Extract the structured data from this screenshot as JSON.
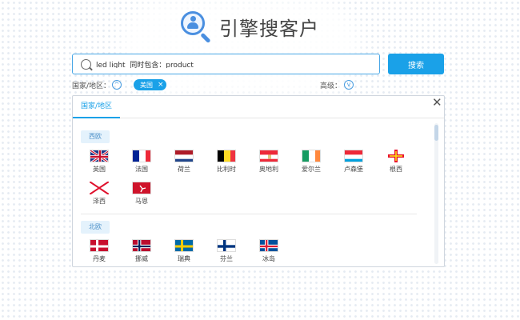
{
  "header": {
    "title": "引擎搜客户",
    "logo_icon": "search-person-icon"
  },
  "search": {
    "value": "led light  同时包含：product",
    "button_label": "搜索"
  },
  "filters": {
    "country_label": "国家/地区：",
    "selected_tag": "美国",
    "advanced_label": "高级："
  },
  "panel": {
    "tab_label": "国家/地区",
    "regions": [
      {
        "name": "西欧",
        "countries": [
          "英国",
          "法国",
          "荷兰",
          "比利时",
          "奥地利",
          "爱尔兰",
          "卢森堡",
          "根西",
          "泽西",
          "马恩"
        ]
      },
      {
        "name": "北欧",
        "countries": [
          "丹麦",
          "挪威",
          "瑞典",
          "芬兰",
          "冰岛"
        ]
      }
    ]
  },
  "colors": {
    "accent": "#1aa1e8",
    "tag_bg": "#1aa1e8"
  }
}
